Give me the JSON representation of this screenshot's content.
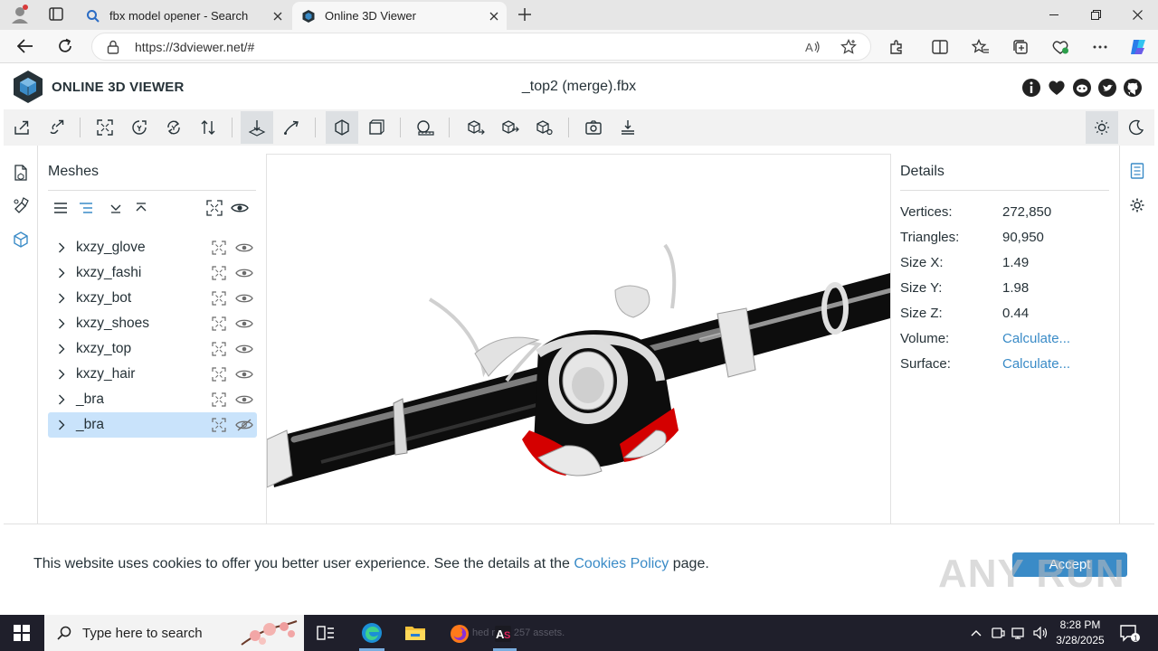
{
  "browser": {
    "tabs": [
      {
        "label": "fbx model opener - Search",
        "icon": "search-icon",
        "active": false
      },
      {
        "label": "Online 3D Viewer",
        "icon": "o3dv-favicon",
        "active": true
      }
    ],
    "url": "https://3dviewer.net/#"
  },
  "app": {
    "brand": "ONLINE 3D VIEWER",
    "filename": "_top2 (merge).fbx",
    "header_icons": [
      "info-icon",
      "heart-icon",
      "discord-icon",
      "twitter-icon",
      "github-icon"
    ],
    "toolbar_icons": [
      "open-file-icon",
      "open-url-icon",
      "fit-to-window-icon",
      "y-up-icon",
      "flip-up-icon",
      "fix-up-icon",
      "orbit-mode-icon",
      "free-orbit-icon",
      "perspective-camera-icon",
      "orthographic-camera-icon",
      "measure-icon",
      "export-icon",
      "share-icon",
      "snapshot-icon",
      "screenshot-icon",
      "download-icon",
      "light-mode-icon",
      "dark-mode-icon"
    ]
  },
  "meshes": {
    "title": "Meshes",
    "items": [
      {
        "name": "kxzy_glove",
        "visible": true,
        "selected": false
      },
      {
        "name": "kxzy_fashi",
        "visible": true,
        "selected": false
      },
      {
        "name": "kxzy_bot",
        "visible": true,
        "selected": false
      },
      {
        "name": "kxzy_shoes",
        "visible": true,
        "selected": false
      },
      {
        "name": "kxzy_top",
        "visible": true,
        "selected": false
      },
      {
        "name": "kxzy_hair",
        "visible": true,
        "selected": false
      },
      {
        "name": "_bra",
        "visible": true,
        "selected": false
      },
      {
        "name": "_bra",
        "visible": false,
        "selected": true
      }
    ]
  },
  "details": {
    "title": "Details",
    "rows": [
      {
        "key": "Vertices:",
        "value": "272,850",
        "link": false
      },
      {
        "key": "Triangles:",
        "value": "90,950",
        "link": false
      },
      {
        "key": "Size X:",
        "value": "1.49",
        "link": false
      },
      {
        "key": "Size Y:",
        "value": "1.98",
        "link": false
      },
      {
        "key": "Size Z:",
        "value": "0.44",
        "link": false
      },
      {
        "key": "Volume:",
        "value": "Calculate...",
        "link": true
      },
      {
        "key": "Surface:",
        "value": "Calculate...",
        "link": true
      }
    ]
  },
  "cookie": {
    "text_before": "This website uses cookies to offer you better user experience. See the details at the ",
    "link_text": "Cookies Policy",
    "text_after": " page.",
    "accept_label": "Accept",
    "watermark": "ANY RUN"
  },
  "taskbar": {
    "search_placeholder": "Type here to search",
    "ghost_text": "hed   rting 257 assets.",
    "time": "8:28 PM",
    "date": "3/28/2025"
  },
  "colors": {
    "accent": "#3a8bc7",
    "selected_row": "#c9e3fb",
    "taskbar": "#1f1f2b"
  }
}
